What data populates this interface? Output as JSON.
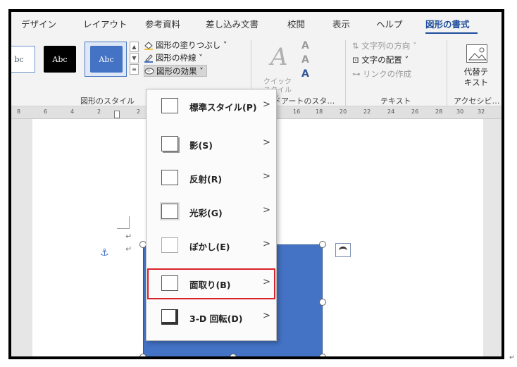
{
  "tabs": [
    {
      "label": "デザイン",
      "active": false
    },
    {
      "label": "レイアウト",
      "active": false
    },
    {
      "label": "参考資料",
      "active": false
    },
    {
      "label": "差し込み文書",
      "active": false
    },
    {
      "label": "校閲",
      "active": false
    },
    {
      "label": "表示",
      "active": false
    },
    {
      "label": "ヘルプ",
      "active": false
    },
    {
      "label": "図形の書式",
      "active": true
    }
  ],
  "ribbon": {
    "shape_styles": {
      "swatch_label": "Abc",
      "swatch_label_partial": "bc",
      "fill": "図形の塗りつぶし ˅",
      "outline": "図形の枠線 ˅",
      "effects": "図形の効果 ˅",
      "group_label": "図形のスタイル"
    },
    "wordart": {
      "quick_style": "クイック\nスタイル ˅",
      "group_label": "ワードアートのスタ…",
      "a_glyph": "A",
      "wordart_glyph": "A"
    },
    "text": {
      "direction": "文字列の方向 ˅",
      "align": "文字の配置 ˅",
      "link": "リンクの作成",
      "group_label": "テキスト"
    },
    "accessibility": {
      "alt_text": "代替テ\nキスト",
      "group_label": "アクセシビ…"
    }
  },
  "ruler": {
    "numbers": [
      "8",
      "6",
      "4",
      "2",
      "2",
      "16",
      "18",
      "20",
      "22",
      "24",
      "26",
      "28",
      "30",
      "32"
    ]
  },
  "menu": {
    "items": [
      {
        "label": "標準スタイル(P)",
        "highlighted": false
      },
      {
        "label": "影(S)",
        "highlighted": false
      },
      {
        "label": "反射(R)",
        "highlighted": false
      },
      {
        "label": "光彩(G)",
        "highlighted": false
      },
      {
        "label": "ぼかし(E)",
        "highlighted": false
      },
      {
        "label": "面取り(B)",
        "highlighted": true
      },
      {
        "label": "3-D 回転(D)",
        "highlighted": false
      }
    ],
    "arrow": ">"
  },
  "doc": {
    "para_mark": "↵",
    "anchor": "⚓"
  },
  "colors": {
    "accent": "#1f4e9c",
    "shape_fill": "#4472c4",
    "highlight_box": "#d9232a"
  }
}
